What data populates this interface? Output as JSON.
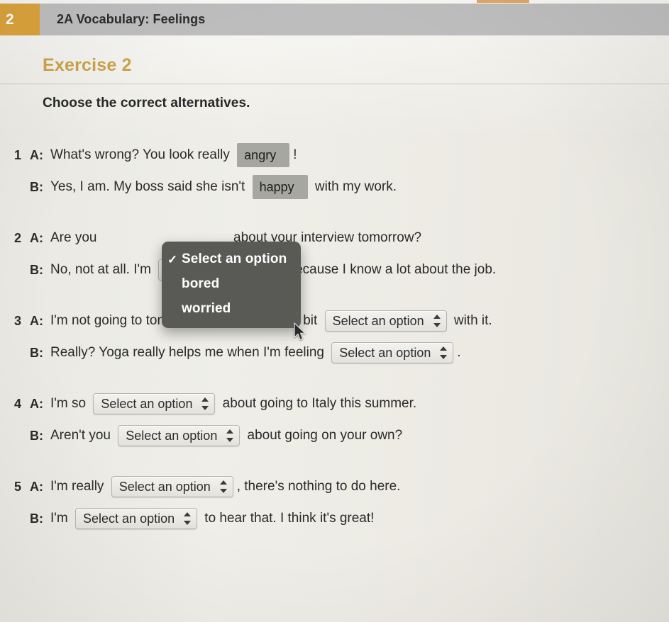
{
  "header": {
    "unit_number": "2",
    "title": "2A Vocabulary: Feelings"
  },
  "exercise": {
    "title": "Exercise 2",
    "instruction": "Choose the correct alternatives."
  },
  "select_placeholder": "Select an option",
  "open_dropdown": {
    "options": [
      {
        "label": "Select an option",
        "checked": true
      },
      {
        "label": "bored",
        "checked": false
      },
      {
        "label": "worried",
        "checked": false
      }
    ]
  },
  "colors": {
    "accent_orange": "#d9a23c",
    "title_gold": "#c9a24a",
    "header_bar": "#bdbdbd",
    "menu_bg": "#595a56",
    "filled_select": "#a7a7a2"
  },
  "questions": [
    {
      "number": "1",
      "lines": [
        {
          "speaker": "A:",
          "parts": [
            {
              "type": "text",
              "text": "What's wrong? You look really "
            },
            {
              "type": "select",
              "value": "angry",
              "state": "filled"
            },
            {
              "type": "text",
              "text": "!"
            }
          ]
        },
        {
          "speaker": "B:",
          "parts": [
            {
              "type": "text",
              "text": "Yes, I am. My boss said she isn't "
            },
            {
              "type": "select",
              "value": "happy",
              "state": "filled"
            },
            {
              "type": "text",
              "text": " with my work."
            }
          ]
        }
      ]
    },
    {
      "number": "2",
      "lines": [
        {
          "speaker": "A:",
          "parts": [
            {
              "type": "text",
              "text": "Are you "
            },
            {
              "type": "select",
              "value": "Select an option",
              "state": "open"
            },
            {
              "type": "text",
              "text": " about your interview tomorrow?"
            }
          ]
        },
        {
          "speaker": "B:",
          "parts": [
            {
              "type": "text",
              "text": "No, not at all. I'm "
            },
            {
              "type": "select",
              "value": "Select an option",
              "state": "default"
            },
            {
              "type": "text",
              "text": " because I know a lot about the job."
            }
          ]
        }
      ]
    },
    {
      "number": "3",
      "lines": [
        {
          "speaker": "A:",
          "parts": [
            {
              "type": "text",
              "text": "I'm not going to tonight's yoga class. I'm a bit "
            },
            {
              "type": "select",
              "value": "Select an option",
              "state": "default"
            },
            {
              "type": "text",
              "text": " with it."
            }
          ]
        },
        {
          "speaker": "B:",
          "parts": [
            {
              "type": "text",
              "text": "Really? Yoga really helps me when I'm feeling "
            },
            {
              "type": "select",
              "value": "Select an option",
              "state": "default"
            },
            {
              "type": "text",
              "text": "."
            }
          ]
        }
      ]
    },
    {
      "number": "4",
      "lines": [
        {
          "speaker": "A:",
          "parts": [
            {
              "type": "text",
              "text": "I'm so "
            },
            {
              "type": "select",
              "value": "Select an option",
              "state": "default"
            },
            {
              "type": "text",
              "text": " about going to Italy this summer."
            }
          ]
        },
        {
          "speaker": "B:",
          "parts": [
            {
              "type": "text",
              "text": "Aren't you "
            },
            {
              "type": "select",
              "value": "Select an option",
              "state": "default"
            },
            {
              "type": "text",
              "text": " about going on your own?"
            }
          ]
        }
      ]
    },
    {
      "number": "5",
      "lines": [
        {
          "speaker": "A:",
          "parts": [
            {
              "type": "text",
              "text": "I'm really "
            },
            {
              "type": "select",
              "value": "Select an option",
              "state": "default"
            },
            {
              "type": "text",
              "text": ", there's nothing to do here."
            }
          ]
        },
        {
          "speaker": "B:",
          "parts": [
            {
              "type": "text",
              "text": "I'm "
            },
            {
              "type": "select",
              "value": "Select an option",
              "state": "default"
            },
            {
              "type": "text",
              "text": " to hear that. I think it's great!"
            }
          ]
        }
      ]
    }
  ]
}
